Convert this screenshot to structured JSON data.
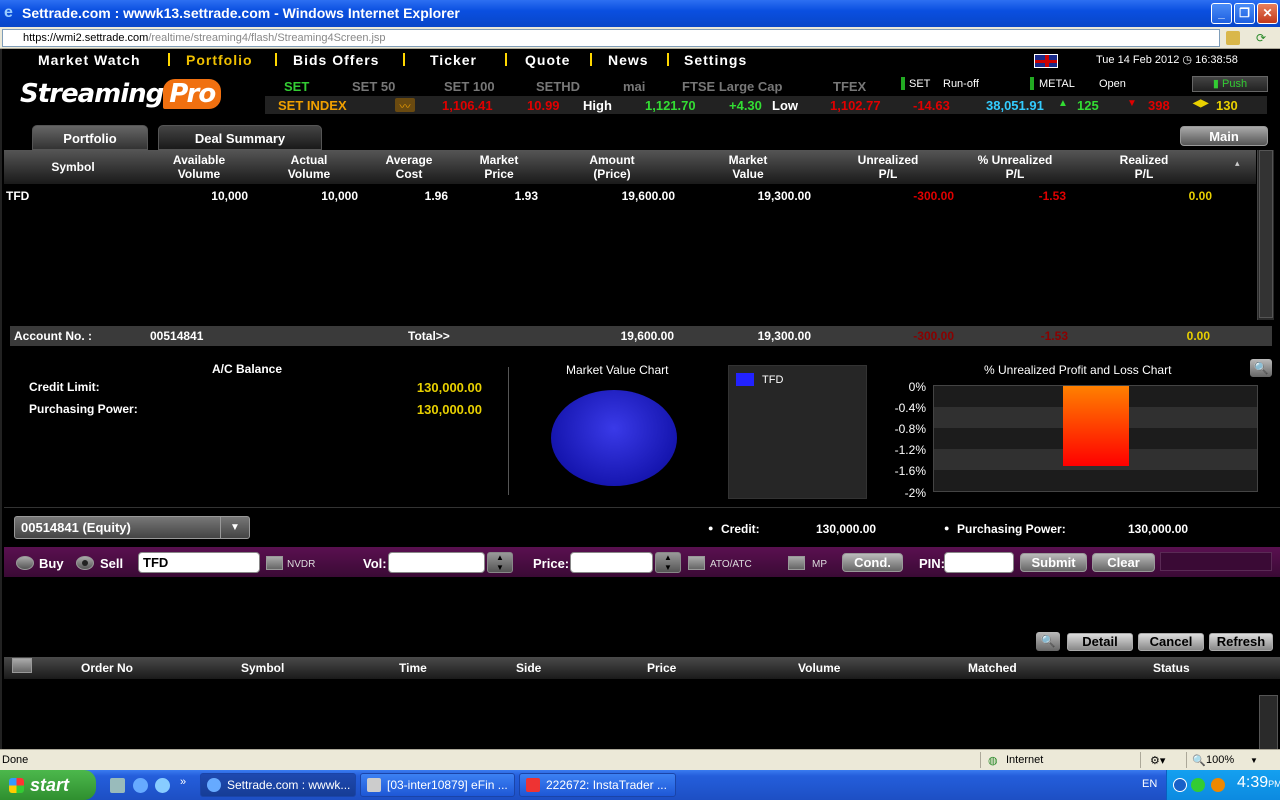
{
  "window": {
    "title": "Settrade.com : wwwk13.settrade.com - Windows Internet Explorer",
    "url_host": "https://wmi2.settrade.com",
    "url_path": "/realtime/streaming4/flash/Streaming4Screen.jsp"
  },
  "nav": {
    "items": [
      "Market Watch",
      "Portfolio",
      "Bids Offers",
      "Ticker",
      "Quote",
      "News",
      "Settings"
    ],
    "active": "Portfolio",
    "datetime": "Tue 14 Feb 2012  ◷ 16:38:58"
  },
  "logo": {
    "main": "Streaming",
    "suffix": "Pro"
  },
  "index_tabs": [
    "SET",
    "SET 50",
    "SET 100",
    "SETHD",
    "mai",
    "FTSE Large Cap",
    "TFEX"
  ],
  "market_status": {
    "set_label": "SET",
    "set_state": "Run-off",
    "metal_label": "METAL",
    "metal_state": "Open",
    "push_label": "Push"
  },
  "index_strip": {
    "name": "SET INDEX",
    "last": "1,106.41",
    "change": "10.99",
    "high_label": "High",
    "high": "1,121.70",
    "high_change": "+4.30",
    "low_label": "Low",
    "low": "1,102.77",
    "low_change": "-14.63",
    "value": "38,051.91",
    "up": "125",
    "down": "398",
    "unchanged": "130"
  },
  "subtabs": {
    "portfolio": "Portfolio",
    "deal": "Deal Summary",
    "main": "Main"
  },
  "portfolio": {
    "headers": [
      [
        "Symbol"
      ],
      [
        "Available",
        "Volume"
      ],
      [
        "Actual",
        "Volume"
      ],
      [
        "Average",
        "Cost"
      ],
      [
        "Market",
        "Price"
      ],
      [
        "Amount",
        "(Price)"
      ],
      [
        "Market",
        "Value"
      ],
      [
        "Unrealized",
        "P/L"
      ],
      [
        "% Unrealized",
        "P/L"
      ],
      [
        "Realized",
        "P/L"
      ]
    ],
    "rows": [
      {
        "symbol": "TFD",
        "available_volume": "10,000",
        "actual_volume": "10,000",
        "average_cost": "1.96",
        "market_price": "1.93",
        "amount_price": "19,600.00",
        "market_value": "19,300.00",
        "unrealized_pl": "-300.00",
        "pct_unrealized_pl": "-1.53",
        "realized_pl": "0.00"
      }
    ],
    "totals": {
      "account_label": "Account No. :",
      "account_no": "00514841",
      "total_label": "Total>>",
      "amount": "19,600.00",
      "market_value": "19,300.00",
      "unrealized": "-300.00",
      "pct_unrealized": "-1.53",
      "realized": "0.00"
    }
  },
  "balance": {
    "title": "A/C Balance",
    "credit_label": "Credit Limit:",
    "credit": "130,000.00",
    "pp_label": "Purchasing Power:",
    "pp": "130,000.00"
  },
  "charts": {
    "mv_title": "Market Value Chart",
    "pl_title": "% Unrealized Profit and Loss Chart"
  },
  "chart_data": [
    {
      "type": "pie",
      "title": "Market Value Chart",
      "categories": [
        "TFD"
      ],
      "values": [
        19300.0
      ],
      "colors": [
        "#2222ff"
      ]
    },
    {
      "type": "bar",
      "title": "% Unrealized Profit and Loss Chart",
      "categories": [
        "TFD"
      ],
      "values": [
        -1.53
      ],
      "y_ticks": [
        "0%",
        "-0.4%",
        "-0.8%",
        "-1.2%",
        "-1.6%",
        "-2%"
      ],
      "ylim": [
        -2,
        0
      ],
      "grid": true
    }
  ],
  "account_select": {
    "value": "00514841 (Equity)"
  },
  "summary": {
    "credit_label": "Credit:",
    "credit": "130,000.00",
    "pp_label": "Purchasing Power:",
    "pp": "130,000.00"
  },
  "order": {
    "buy": "Buy",
    "sell": "Sell",
    "symbol": "TFD",
    "nvdr": "NVDR",
    "vol_label": "Vol:",
    "price_label": "Price:",
    "atoatc": "ATO/ATC",
    "mp": "MP",
    "cond": "Cond.",
    "pin_label": "PIN:",
    "submit": "Submit",
    "clear": "Clear"
  },
  "actions": {
    "detail": "Detail",
    "cancel": "Cancel",
    "refresh": "Refresh"
  },
  "orders_table": {
    "headers": [
      "Order No",
      "Symbol",
      "Time",
      "Side",
      "Price",
      "Volume",
      "Matched",
      "Status"
    ]
  },
  "ie_status": {
    "left": "Done",
    "zone": "Internet",
    "zoom": "100%"
  },
  "taskbar": {
    "start": "start",
    "tasks": [
      "Settrade.com : wwwk...",
      "[03-inter10879] eFin ...",
      "222672: InstaTrader ..."
    ],
    "lang": "EN",
    "clock": "4:39",
    "ampm": "PM"
  },
  "colors": {
    "accent": "#f0c000",
    "up": "#33dd33",
    "down": "#e00000",
    "value": "#e8d000",
    "order_bar": "#5a1050"
  }
}
